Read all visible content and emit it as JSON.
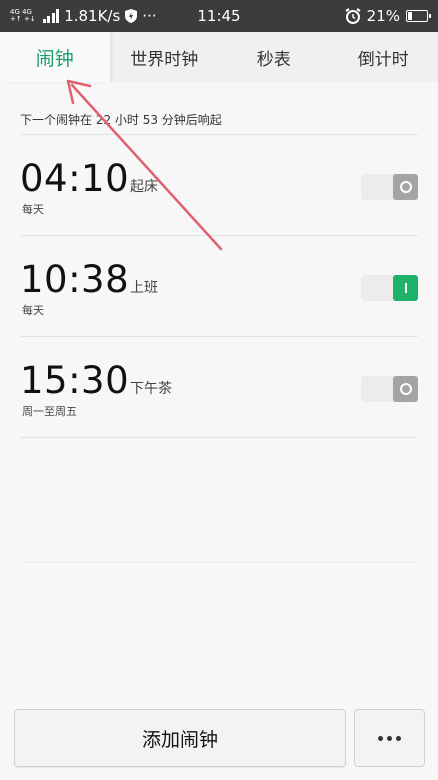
{
  "status_bar": {
    "network_top": "4G 4G",
    "network_bottom": "+↑ +↓",
    "speed": "1.81K/s",
    "more": "···",
    "time": "11:45",
    "battery": "21%",
    "battery_level": 0.21
  },
  "tabs": [
    {
      "label": "闹钟",
      "active": true
    },
    {
      "label": "世界时钟",
      "active": false
    },
    {
      "label": "秒表",
      "active": false
    },
    {
      "label": "倒计时",
      "active": false
    }
  ],
  "next_alarm": "下一个闹钟在 22 小时 53 分钟后响起",
  "alarms": [
    {
      "time": "04:10",
      "label": "起床",
      "repeat": "每天",
      "enabled": false
    },
    {
      "time": "10:38",
      "label": "上班",
      "repeat": "每天",
      "enabled": true
    },
    {
      "time": "15:30",
      "label": "下午茶",
      "repeat": "周一至周五",
      "enabled": false
    }
  ],
  "bottom": {
    "add_label": "添加闹钟"
  },
  "colors": {
    "accent": "#1aa06a",
    "toggle_on": "#1db36b",
    "toggle_off": "#a4a4a4",
    "annotation_arrow": "#e06070"
  }
}
